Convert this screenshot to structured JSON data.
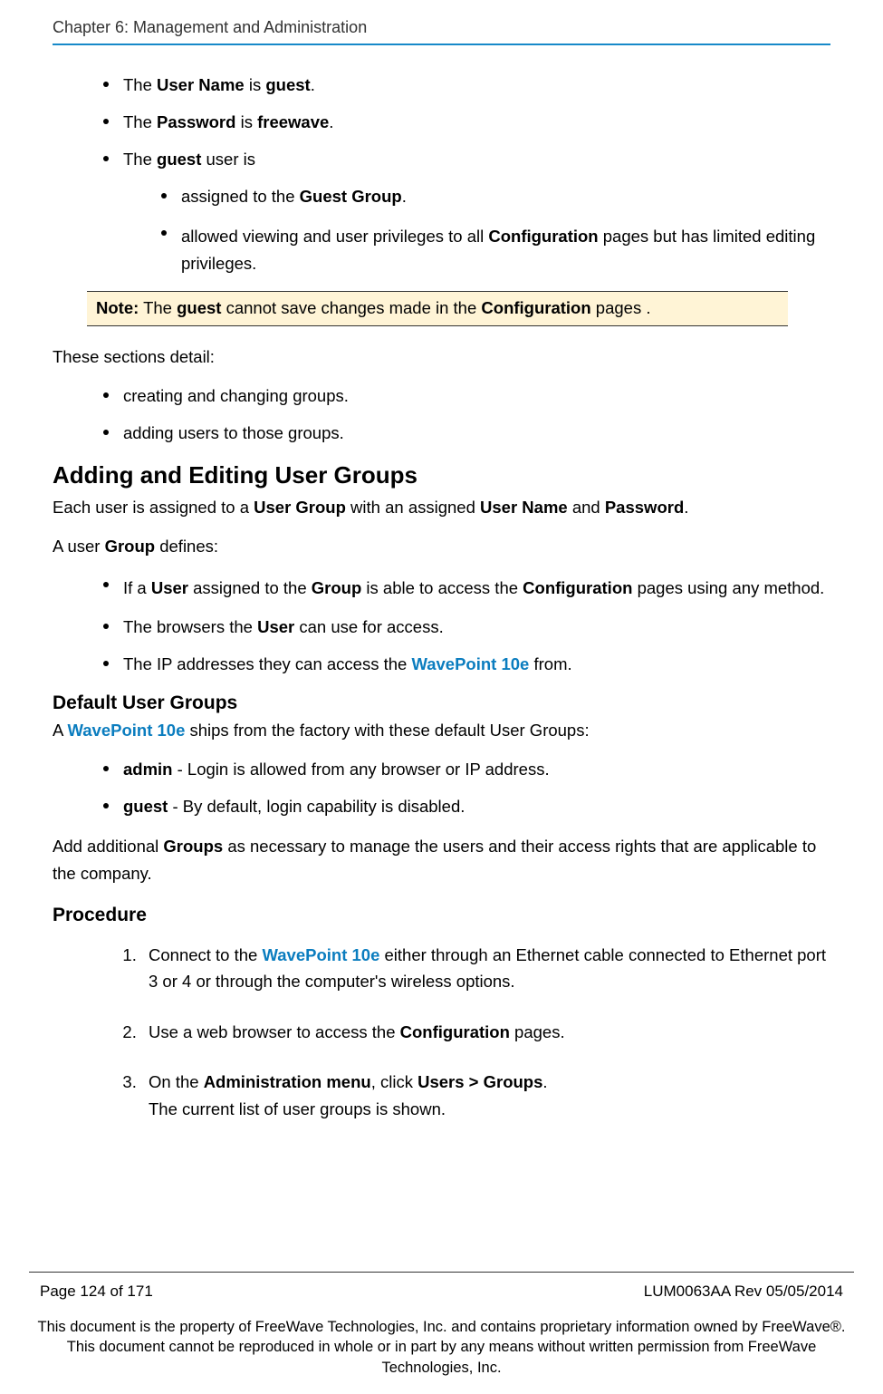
{
  "header": {
    "chapter": "Chapter 6: Management and Administration"
  },
  "intro_bullets": {
    "b1_pre": "The ",
    "b1_bold1": "User Name",
    "b1_mid": " is ",
    "b1_bold2": "guest",
    "b1_end": ".",
    "b2_pre": "The ",
    "b2_bold1": "Password",
    "b2_mid": " is ",
    "b2_bold2": "freewave",
    "b2_end": ".",
    "b3_pre": "The ",
    "b3_bold1": "guest",
    "b3_post": " user is",
    "sub1_pre": "assigned to the ",
    "sub1_bold": "Guest Group",
    "sub1_end": ".",
    "sub2_pre": "allowed viewing and user privileges to all ",
    "sub2_bold": "Configuration",
    "sub2_post": " pages but has limited editing privileges."
  },
  "note": {
    "label": "Note:",
    "pre": " The ",
    "bold1": "guest",
    "mid": " cannot save changes made in the ",
    "bold2": "Configuration",
    "post": " pages ."
  },
  "sections_detail": {
    "lead": "These sections detail:",
    "s1": "creating and changing groups.",
    "s2": "adding users to those groups."
  },
  "h2_adding": "Adding and Editing User Groups",
  "p_each_pre": "Each user is assigned to a ",
  "p_each_b1": "User Group",
  "p_each_mid": " with an assigned ",
  "p_each_b2": "User Name",
  "p_each_and": " and ",
  "p_each_b3": "Password",
  "p_each_end": ".",
  "p_defines_pre": "A user ",
  "p_defines_bold": "Group",
  "p_defines_post": " defines:",
  "groupdef": {
    "g1a": "If a ",
    "g1b": "User",
    "g1c": " assigned to the ",
    "g1d": "Group",
    "g1e": " is able to access the ",
    "g1f": "Configuration",
    "g1g": " pages using any method.",
    "g2a": "The browsers the ",
    "g2b": "User",
    "g2c": " can use for access.",
    "g3a": "The IP addresses they can access the ",
    "g3link": "WavePoint 10e",
    "g3b": " from."
  },
  "h3_default": "Default User Groups",
  "default_p_pre": "A ",
  "default_p_link": "WavePoint 10e",
  "default_p_post": " ships from the factory with these default User Groups:",
  "defaults": {
    "d1b": "admin",
    "d1t": " - Login is allowed from any browser or IP address.",
    "d2b": "guest",
    "d2t": " - By default, login capability is disabled."
  },
  "addl_pre": "Add additional ",
  "addl_bold": "Groups",
  "addl_post": " as necessary to manage the users and their access rights that are applicable to the company.",
  "h3_proc": "Procedure",
  "proc": {
    "p1a": "Connect to the ",
    "p1link": "WavePoint 10e",
    "p1b": " either through an Ethernet cable connected to Ethernet port 3 or 4 or through the computer's wireless options.",
    "p2a": "Use a web browser to access the ",
    "p2b": "Configuration",
    "p2c": " pages.",
    "p3a": "On the ",
    "p3b": "Administration menu",
    "p3c": ", click ",
    "p3d": "Users > Groups",
    "p3e": ".",
    "p3f": "The current list of user groups is shown."
  },
  "footer": {
    "page": "Page 124 of 171",
    "rev": "LUM0063AA Rev 05/05/2014",
    "legal": "This document is the property of FreeWave Technologies, Inc. and contains proprietary information owned by FreeWave®. This document cannot be reproduced in whole or in part by any means without written permission from FreeWave Technologies, Inc."
  }
}
